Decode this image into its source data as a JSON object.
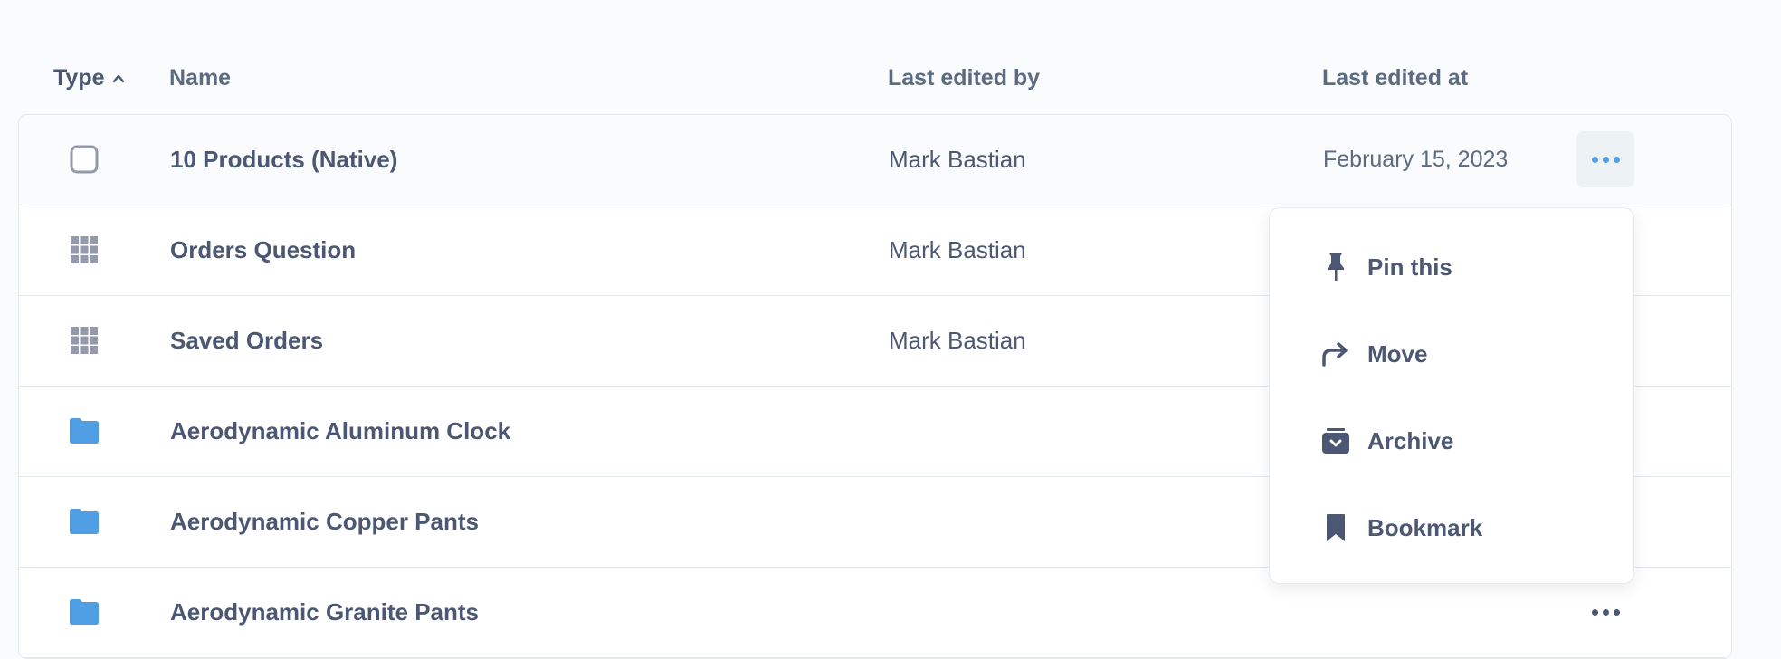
{
  "header": {
    "type": "Type",
    "name": "Name",
    "last_edited_by": "Last edited by",
    "last_edited_at": "Last edited at"
  },
  "rows": [
    {
      "icon": "checkbox-icon",
      "name": "10 Products (Native)",
      "editor": "Mark Bastian",
      "date": "February 15, 2023"
    },
    {
      "icon": "table-grid-icon",
      "name": "Orders Question",
      "editor": "Mark Bastian",
      "date": ""
    },
    {
      "icon": "table-grid-icon",
      "name": "Saved Orders",
      "editor": "Mark Bastian",
      "date": ""
    },
    {
      "icon": "folder-icon",
      "name": "Aerodynamic Aluminum Clock",
      "editor": "",
      "date": ""
    },
    {
      "icon": "folder-icon",
      "name": "Aerodynamic Copper Pants",
      "editor": "",
      "date": ""
    },
    {
      "icon": "folder-icon",
      "name": "Aerodynamic Granite Pants",
      "editor": "",
      "date": ""
    }
  ],
  "menu": {
    "items": [
      {
        "label": "Pin this",
        "icon": "pin-icon"
      },
      {
        "label": "Move",
        "icon": "move-arrow-icon"
      },
      {
        "label": "Archive",
        "icon": "archive-icon"
      },
      {
        "label": "Bookmark",
        "icon": "bookmark-icon"
      }
    ]
  },
  "colors": {
    "accent": "#509ee3",
    "text": "#4c5773",
    "border": "#e3e8ee",
    "icon_gray": "#949aab"
  }
}
